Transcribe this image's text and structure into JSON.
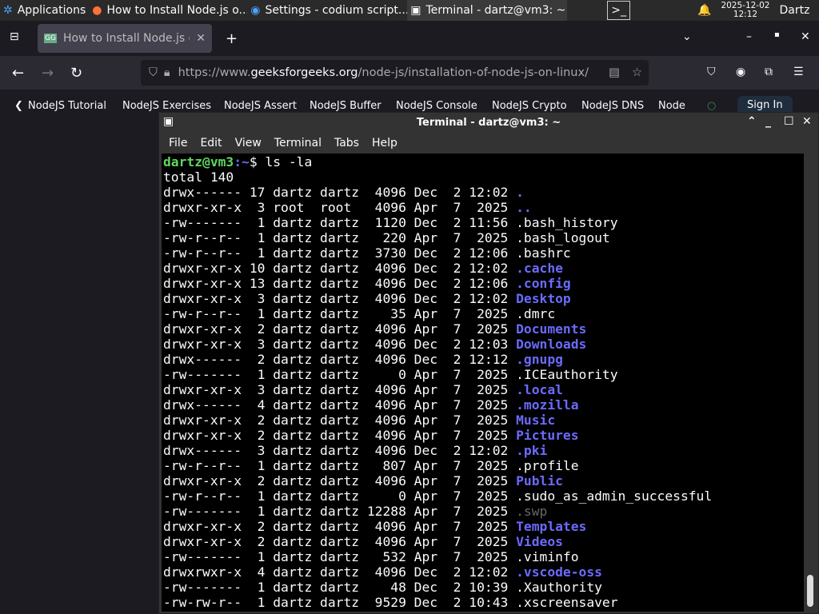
{
  "panel": {
    "apps_label": "Applications",
    "tasks": [
      "How to Install Node.js o...",
      "Settings - codium script...",
      "Terminal - dartz@vm3: ~"
    ],
    "date": "2025-12-02",
    "time": "12:12",
    "user": "Dartz"
  },
  "browser": {
    "tab_title": "How to Install Node.js on",
    "url_prefix": "https://www.",
    "url_domain": "geeksforgeeks.org",
    "url_path": "/node-js/installation-of-node-js-on-linux/",
    "bookmarks": [
      "NodeJS Tutorial",
      "NodeJS Exercises",
      "NodeJS Assert",
      "NodeJS Buffer",
      "NodeJS Console",
      "NodeJS Crypto",
      "NodeJS DNS",
      "Node"
    ],
    "sign_in": "Sign In"
  },
  "terminal": {
    "title": "Terminal - dartz@vm3: ~",
    "menu": [
      "File",
      "Edit",
      "View",
      "Terminal",
      "Tabs",
      "Help"
    ],
    "prompt_user": "dartz@vm3",
    "prompt_path": ":~",
    "prompt_sym": "$ ",
    "command": "ls -la",
    "total": "total 140",
    "rows": [
      [
        "drwx------ 17 dartz dartz  4096 Dec  2 12:02 ",
        ".",
        "dir"
      ],
      [
        "drwxr-xr-x  3 root  root   4096 Apr  7  2025 ",
        "..",
        "dir"
      ],
      [
        "-rw-------  1 dartz dartz  1120 Dec  2 11:56 ",
        ".bash_history",
        "file"
      ],
      [
        "-rw-r--r--  1 dartz dartz   220 Apr  7  2025 ",
        ".bash_logout",
        "file"
      ],
      [
        "-rw-r--r--  1 dartz dartz  3730 Dec  2 12:06 ",
        ".bashrc",
        "file"
      ],
      [
        "drwxr-xr-x 10 dartz dartz  4096 Dec  2 12:02 ",
        ".cache",
        "dir"
      ],
      [
        "drwxr-xr-x 13 dartz dartz  4096 Dec  2 12:06 ",
        ".config",
        "dir"
      ],
      [
        "drwxr-xr-x  3 dartz dartz  4096 Dec  2 12:02 ",
        "Desktop",
        "dir"
      ],
      [
        "-rw-r--r--  1 dartz dartz    35 Apr  7  2025 ",
        ".dmrc",
        "file"
      ],
      [
        "drwxr-xr-x  2 dartz dartz  4096 Apr  7  2025 ",
        "Documents",
        "dir"
      ],
      [
        "drwxr-xr-x  3 dartz dartz  4096 Dec  2 12:03 ",
        "Downloads",
        "dir"
      ],
      [
        "drwx------  2 dartz dartz  4096 Dec  2 12:12 ",
        ".gnupg",
        "dir"
      ],
      [
        "-rw-------  1 dartz dartz     0 Apr  7  2025 ",
        ".ICEauthority",
        "file"
      ],
      [
        "drwxr-xr-x  3 dartz dartz  4096 Apr  7  2025 ",
        ".local",
        "dir"
      ],
      [
        "drwx------  4 dartz dartz  4096 Apr  7  2025 ",
        ".mozilla",
        "dir"
      ],
      [
        "drwxr-xr-x  2 dartz dartz  4096 Apr  7  2025 ",
        "Music",
        "dir"
      ],
      [
        "drwxr-xr-x  2 dartz dartz  4096 Apr  7  2025 ",
        "Pictures",
        "dir"
      ],
      [
        "drwx------  3 dartz dartz  4096 Dec  2 12:02 ",
        ".pki",
        "dir"
      ],
      [
        "-rw-r--r--  1 dartz dartz   807 Apr  7  2025 ",
        ".profile",
        "file"
      ],
      [
        "drwxr-xr-x  2 dartz dartz  4096 Apr  7  2025 ",
        "Public",
        "dir"
      ],
      [
        "-rw-r--r--  1 dartz dartz     0 Apr  7  2025 ",
        ".sudo_as_admin_successful",
        "file"
      ],
      [
        "-rw-------  1 dartz dartz 12288 Apr  7  2025 ",
        ".swp",
        "dim"
      ],
      [
        "drwxr-xr-x  2 dartz dartz  4096 Apr  7  2025 ",
        "Templates",
        "dir"
      ],
      [
        "drwxr-xr-x  2 dartz dartz  4096 Apr  7  2025 ",
        "Videos",
        "dir"
      ],
      [
        "-rw-------  1 dartz dartz   532 Apr  7  2025 ",
        ".viminfo",
        "file"
      ],
      [
        "drwxrwxr-x  4 dartz dartz  4096 Dec  2 12:02 ",
        ".vscode-oss",
        "dir"
      ],
      [
        "-rw-------  1 dartz dartz    48 Dec  2 10:39 ",
        ".Xauthority",
        "file"
      ],
      [
        "-rw-rw-r--  1 dartz dartz  9529 Dec  2 10:43 ",
        ".xscreensaver",
        "file"
      ]
    ]
  },
  "colors": {
    "prompt": "#5fd75f",
    "dir": "#6b6bff",
    "terminal_bg": "#000000"
  }
}
